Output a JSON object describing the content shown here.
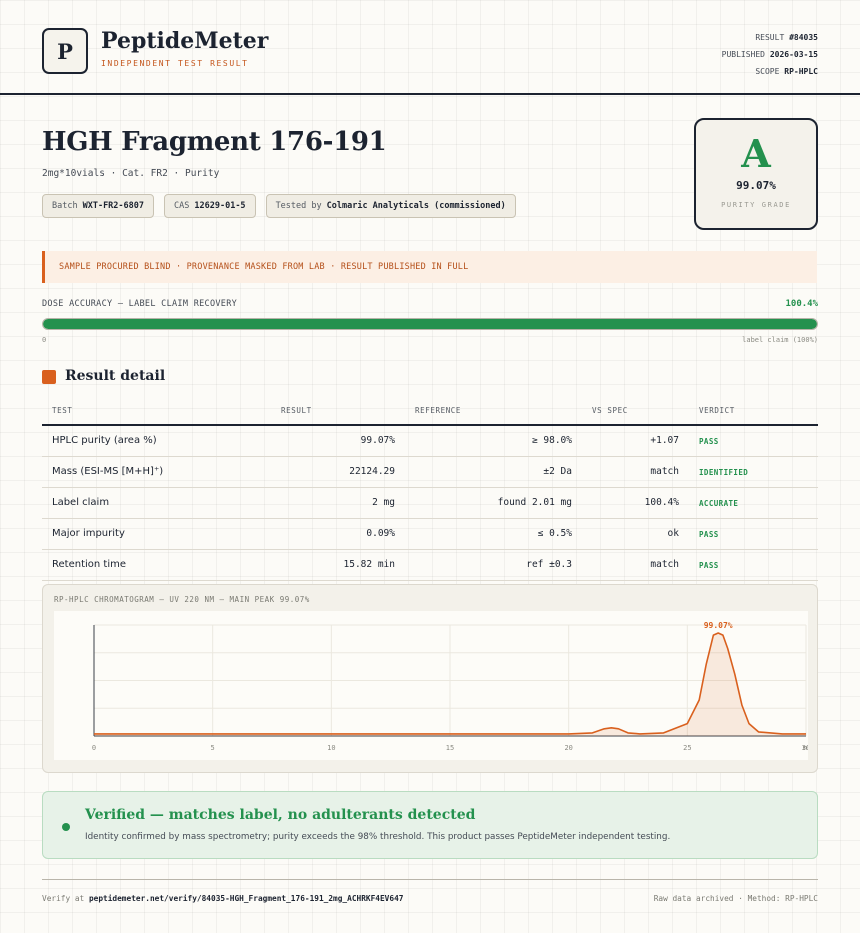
{
  "brand": {
    "logo_letter": "P",
    "name": "PeptideMeter",
    "tagline": "INDEPENDENT TEST RESULT"
  },
  "meta": {
    "result_label": "RESULT",
    "result_value": "#84035",
    "published_label": "PUBLISHED",
    "published_value": "2026-03-15",
    "scope_label": "SCOPE",
    "scope_value": "RP-HPLC"
  },
  "product": {
    "title": "HGH Fragment 176-191",
    "subtitle": "2mg*10vials · Cat. FR2 · Purity",
    "chips": [
      {
        "label": "Batch",
        "value": "WXT-FR2-6807"
      },
      {
        "label": "CAS",
        "value": "12629-01-5"
      },
      {
        "label": "Tested by",
        "value": "Colmaric Analyticals (commissioned)"
      }
    ]
  },
  "grade": {
    "letter": "A",
    "value": "99.07%",
    "label": "PURITY GRADE"
  },
  "banner": {
    "text": "SAMPLE PROCURED BLIND · PROVENANCE MASKED FROM LAB · RESULT PUBLISHED IN FULL"
  },
  "dose": {
    "label": "DOSE ACCURACY — LABEL CLAIM RECOVERY",
    "value": "100.4%",
    "fill_fraction": 1.0,
    "axis_start": "0",
    "axis_end": "label claim (100%)"
  },
  "section": {
    "title": "Result detail"
  },
  "table": {
    "headers": {
      "test": "TEST",
      "result": "RESULT",
      "reference": "REFERENCE",
      "vs_spec": "VS SPEC",
      "verdict": "VERDICT"
    },
    "rows": [
      {
        "test": "HPLC purity (area %)",
        "result": "99.07%",
        "reference": "≥ 98.0%",
        "vs_spec": "+1.07",
        "verdict": "PASS"
      },
      {
        "test": "Mass (ESI-MS [M+H]⁺)",
        "result": "22124.29",
        "reference": "±2 Da",
        "vs_spec": "match",
        "verdict": "IDENTIFIED"
      },
      {
        "test": "Label claim",
        "result": "2 mg",
        "reference": "found 2.01 mg",
        "vs_spec": "100.4%",
        "verdict": "ACCURATE"
      },
      {
        "test": "Major impurity",
        "result": "0.09%",
        "reference": "≤ 0.5%",
        "vs_spec": "ok",
        "verdict": "PASS"
      },
      {
        "test": "Retention time",
        "result": "15.82 min",
        "reference": "ref ±0.3",
        "vs_spec": "match",
        "verdict": "PASS"
      }
    ]
  },
  "chart_data": {
    "type": "line",
    "title": "RP-HPLC CHROMATOGRAM — UV 220 NM — MAIN PEAK 99.07%",
    "xlabel": "",
    "ylabel": "",
    "xlim": [
      0,
      30
    ],
    "x_ticks": [
      "0",
      "5",
      "10",
      "15",
      "20",
      "25",
      "30"
    ],
    "x_unit": "min",
    "grid": true,
    "series": [
      {
        "x": [
          0,
          18,
          20,
          21,
          21.5,
          21.8,
          22.1,
          22.5,
          23,
          24,
          25,
          25.5,
          25.8,
          26.1,
          26.3,
          26.5,
          26.7,
          27.0,
          27.3,
          27.6,
          28,
          29,
          30
        ],
        "y": [
          2,
          2,
          2,
          3,
          7,
          8,
          7,
          3,
          2,
          3,
          12,
          35,
          70,
          98,
          100,
          98,
          85,
          60,
          30,
          12,
          4,
          2,
          2
        ]
      }
    ],
    "annotations": [
      {
        "x": 26.3,
        "y": 100,
        "text": "99.07%"
      }
    ]
  },
  "verified": {
    "title": "Verified — matches label, no adulterants detected",
    "text": "Identity confirmed by mass spectrometry; purity exceeds the 98% threshold. This product passes PeptideMeter independent testing."
  },
  "footer": {
    "verify_prefix": "Verify at",
    "verify_url": "peptidemeter.net/verify/84035-HGH_Fragment_176-191_2mg_ACHRKF4EV647",
    "right_text": "Raw data archived · Method: RP-HPLC"
  },
  "colors": {
    "accent": "#d9601e",
    "pass": "#24914e",
    "ink": "#1c2330"
  }
}
